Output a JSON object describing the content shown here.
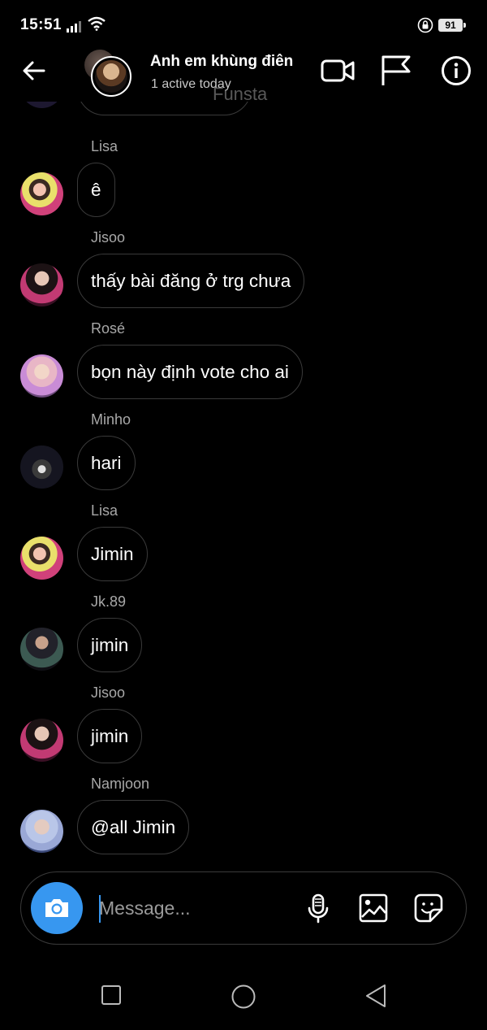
{
  "status_bar": {
    "time": "15:51",
    "battery": "91",
    "icons": [
      "signal-icon",
      "wifi-icon",
      "lock-icon",
      "battery-icon"
    ]
  },
  "header": {
    "title": "Anh em khùng điên",
    "subtitle": "1 active today",
    "watermark": "Funsta",
    "icons": [
      "back-arrow-icon",
      "video-call-icon",
      "flag-icon",
      "info-icon"
    ]
  },
  "messages": [
    {
      "sender": "Lisa",
      "text": "ê",
      "avatar": "lisa"
    },
    {
      "sender": "Jisoo",
      "text": "thấy bài đăng ở trg chưa",
      "avatar": "jisoo"
    },
    {
      "sender": "Rosé",
      "text": "bọn này định vote cho ai",
      "avatar": "rose"
    },
    {
      "sender": "Minho",
      "text": "hari",
      "avatar": "minho"
    },
    {
      "sender": "Lisa",
      "text": "Jimin",
      "avatar": "lisa"
    },
    {
      "sender": "Jk.89",
      "text": "jimin",
      "avatar": "jk"
    },
    {
      "sender": "Jisoo",
      "text": "jimin",
      "avatar": "jisoo"
    },
    {
      "sender": "Namjoon",
      "text": "@all Jimin",
      "avatar": "namjoon"
    }
  ],
  "composer": {
    "placeholder": "Message...",
    "icons": [
      "camera-icon",
      "microphone-icon",
      "gallery-icon",
      "sticker-icon"
    ],
    "accent_color": "#3797f0"
  },
  "nav_bar": {
    "icons": [
      "recents-icon",
      "home-icon",
      "back-icon"
    ]
  }
}
